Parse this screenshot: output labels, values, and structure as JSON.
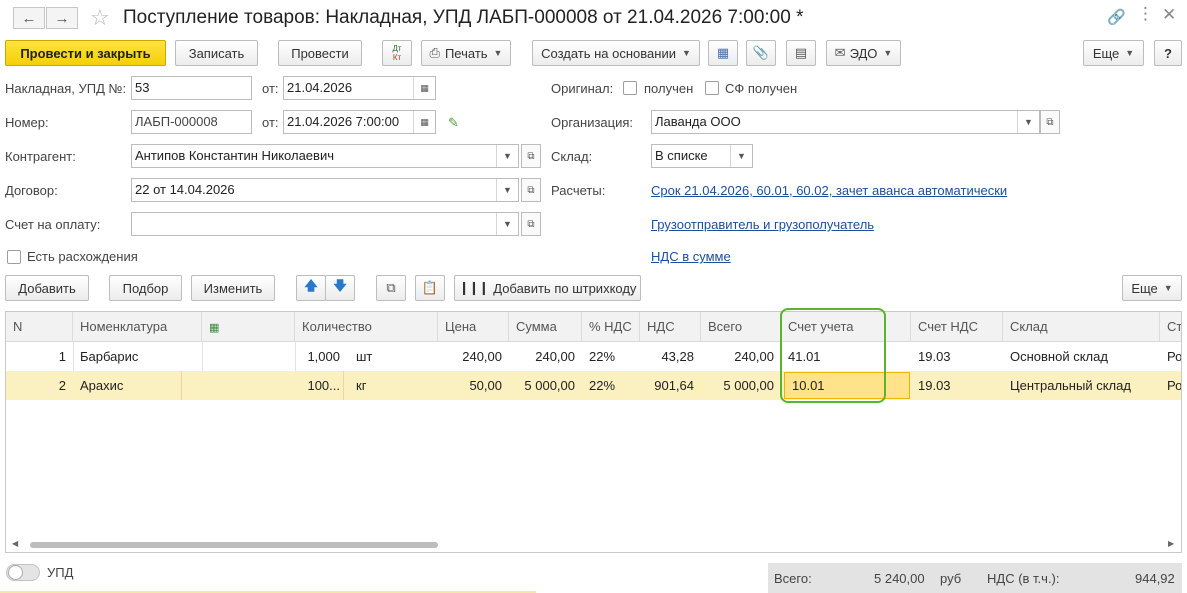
{
  "window": {
    "title": "Поступление товаров: Накладная, УПД ЛАБП-000008 от 21.04.2026 7:00:00 *"
  },
  "toolbar": {
    "post_close": "Провести и закрыть",
    "save": "Записать",
    "post": "Провести",
    "dtkt_top": "Дт",
    "dtkt_bottom": "Кт",
    "print": "Печать",
    "create_based": "Создать на основании",
    "edo": "ЭДО",
    "more": "Еще",
    "help": "?"
  },
  "form": {
    "invoice_label": "Накладная, УПД №:",
    "invoice_value": "53",
    "from_label": "от:",
    "invoice_date": "21.04.2026",
    "number_label": "Номер:",
    "number_value": "ЛАБП-000008",
    "number_date": "21.04.2026  7:00:00",
    "contractor_label": "Контрагент:",
    "contractor_value": "Антипов Константин Николаевич",
    "contract_label": "Договор:",
    "contract_value": "22 от 14.04.2026",
    "bill_label": "Счет на оплату:",
    "bill_value": "",
    "discrepancy_label": "Есть расхождения",
    "original_label": "Оригинал:",
    "received_label": "получен",
    "sf_received_label": "СФ получен",
    "org_label": "Организация:",
    "org_value": "Лаванда ООО",
    "warehouse_label": "Склад:",
    "warehouse_value": "В списке",
    "payments_label": "Расчеты:",
    "payments_link": "Срок 21.04.2026, 60.01, 60.02, зачет аванса автоматически",
    "shipper_link": "Грузоотправитель и грузополучатель",
    "vat_link": "НДС в сумме"
  },
  "table_toolbar": {
    "add": "Добавить",
    "pick": "Подбор",
    "change": "Изменить",
    "barcode": "Добавить по штрихкоду",
    "more": "Еще"
  },
  "table": {
    "columns": [
      "N",
      "Номенклатура",
      "Количество",
      "Цена",
      "Сумма",
      "% НДС",
      "НДС",
      "Всего",
      "Счет учета",
      "Счет НДС",
      "Склад",
      "Ст"
    ],
    "rows": [
      {
        "n": "1",
        "item": "Барбарис",
        "qty": "1,000",
        "unit": "шт",
        "price": "240,00",
        "sum": "240,00",
        "vat_rate": "22%",
        "vat": "43,28",
        "total": "240,00",
        "account": "41.01",
        "vat_account": "19.03",
        "warehouse": "Основной склад",
        "extra": "Ро"
      },
      {
        "n": "2",
        "item": "Арахис",
        "qty": "100...",
        "unit": "кг",
        "price": "50,00",
        "sum": "5 000,00",
        "vat_rate": "22%",
        "vat": "901,64",
        "total": "5 000,00",
        "account": "10.01",
        "vat_account": "19.03",
        "warehouse": "Центральный склад",
        "extra": "Ро"
      }
    ]
  },
  "bottom": {
    "upd_label": "УПД",
    "total_label": "Всего:",
    "total_value": "5 240,00",
    "currency": "руб",
    "vat_label": "НДС (в т.ч.):",
    "vat_value": "944,92"
  },
  "colors": {
    "primary_button": "#f6cf0a",
    "selected_row": "#fbf0c0",
    "highlight_frame": "#5ab52a",
    "link": "#1c4f9c"
  }
}
